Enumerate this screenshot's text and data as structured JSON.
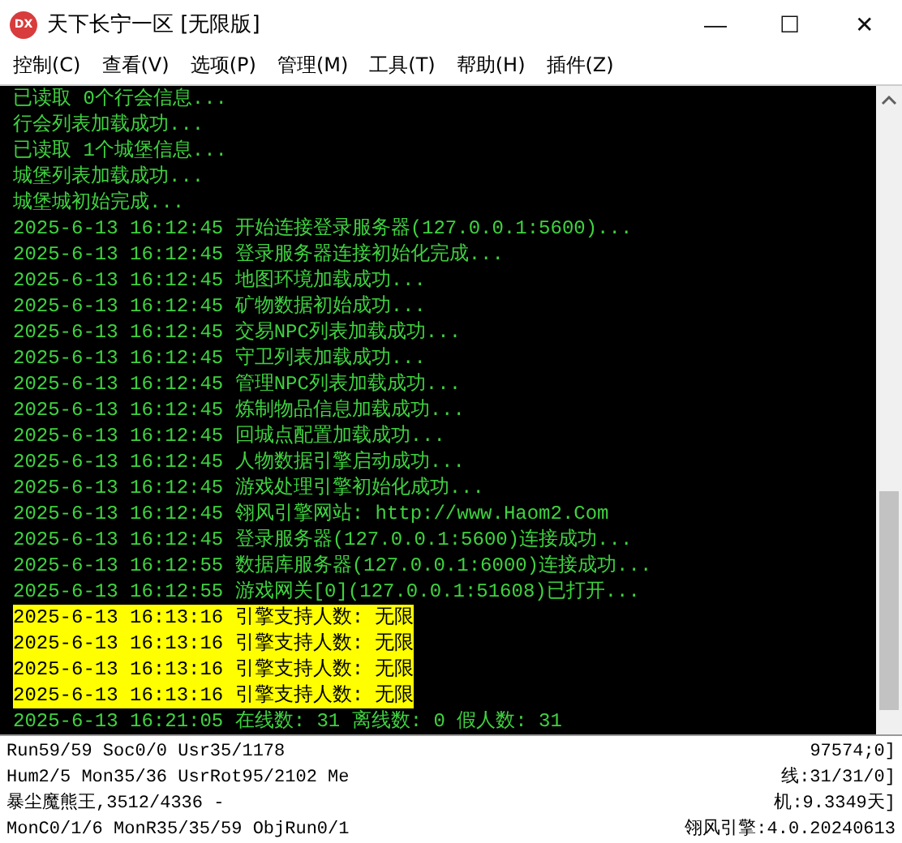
{
  "window": {
    "title": "天下长宁一区 [无限版]",
    "icon_text": "DX",
    "controls": [
      "—",
      "☐",
      "✕"
    ]
  },
  "menu": [
    "控制(C)",
    "查看(V)",
    "选项(P)",
    "管理(M)",
    "工具(T)",
    "帮助(H)",
    "插件(Z)"
  ],
  "log": [
    {
      "text": "已读取 0个行会信息...",
      "highlighted": false
    },
    {
      "text": "行会列表加载成功...",
      "highlighted": false
    },
    {
      "text": "已读取 1个城堡信息...",
      "highlighted": false
    },
    {
      "text": "城堡列表加载成功...",
      "highlighted": false
    },
    {
      "text": "城堡城初始完成...",
      "highlighted": false
    },
    {
      "text": "2025-6-13 16:12:45 开始连接登录服务器(127.0.0.1:5600)...",
      "highlighted": false
    },
    {
      "text": "2025-6-13 16:12:45 登录服务器连接初始化完成...",
      "highlighted": false
    },
    {
      "text": "2025-6-13 16:12:45 地图环境加载成功...",
      "highlighted": false
    },
    {
      "text": "2025-6-13 16:12:45 矿物数据初始成功...",
      "highlighted": false
    },
    {
      "text": "2025-6-13 16:12:45 交易NPC列表加载成功...",
      "highlighted": false
    },
    {
      "text": "2025-6-13 16:12:45 守卫列表加载成功...",
      "highlighted": false
    },
    {
      "text": "2025-6-13 16:12:45 管理NPC列表加载成功...",
      "highlighted": false
    },
    {
      "text": "2025-6-13 16:12:45 炼制物品信息加载成功...",
      "highlighted": false
    },
    {
      "text": "2025-6-13 16:12:45 回城点配置加载成功...",
      "highlighted": false
    },
    {
      "text": "2025-6-13 16:12:45 人物数据引擎启动成功...",
      "highlighted": false
    },
    {
      "text": "2025-6-13 16:12:45 游戏处理引擎初始化成功...",
      "highlighted": false
    },
    {
      "text": "2025-6-13 16:12:45 翎风引擎网站: http://www.Haom2.Com",
      "highlighted": false
    },
    {
      "text": "2025-6-13 16:12:45 登录服务器(127.0.0.1:5600)连接成功...",
      "highlighted": false
    },
    {
      "text": "2025-6-13 16:12:55 数据库服务器(127.0.0.1:6000)连接成功...",
      "highlighted": false
    },
    {
      "text": "2025-6-13 16:12:55 游戏网关[0](127.0.0.1:51608)已打开...",
      "highlighted": false
    },
    {
      "text": "2025-6-13 16:13:16 引擎支持人数: 无限",
      "highlighted": true
    },
    {
      "text": "2025-6-13 16:13:16 引擎支持人数: 无限",
      "highlighted": true
    },
    {
      "text": "2025-6-13 16:13:16 引擎支持人数: 无限",
      "highlighted": true
    },
    {
      "text": "2025-6-13 16:13:16 引擎支持人数: 无限",
      "highlighted": true
    },
    {
      "text": "2025-6-13 16:21:05 在线数: 31 离线数: 0 假人数: 31",
      "highlighted": false
    }
  ],
  "status_bar": [
    {
      "left": "Run59/59 Soc0/0 Usr35/1178",
      "right": "97574;0]"
    },
    {
      "left": "Hum2/5 Mon35/36 UsrRot95/2102 Me",
      "right": "线:31/31/0]"
    },
    {
      "left": "暴尘魔熊王,3512/4336 -",
      "right": "机:9.3349天]"
    },
    {
      "left": "MonC0/1/6 MonR35/35/59 ObjRun0/1",
      "right": "翎风引擎:4.0.20240613"
    }
  ]
}
